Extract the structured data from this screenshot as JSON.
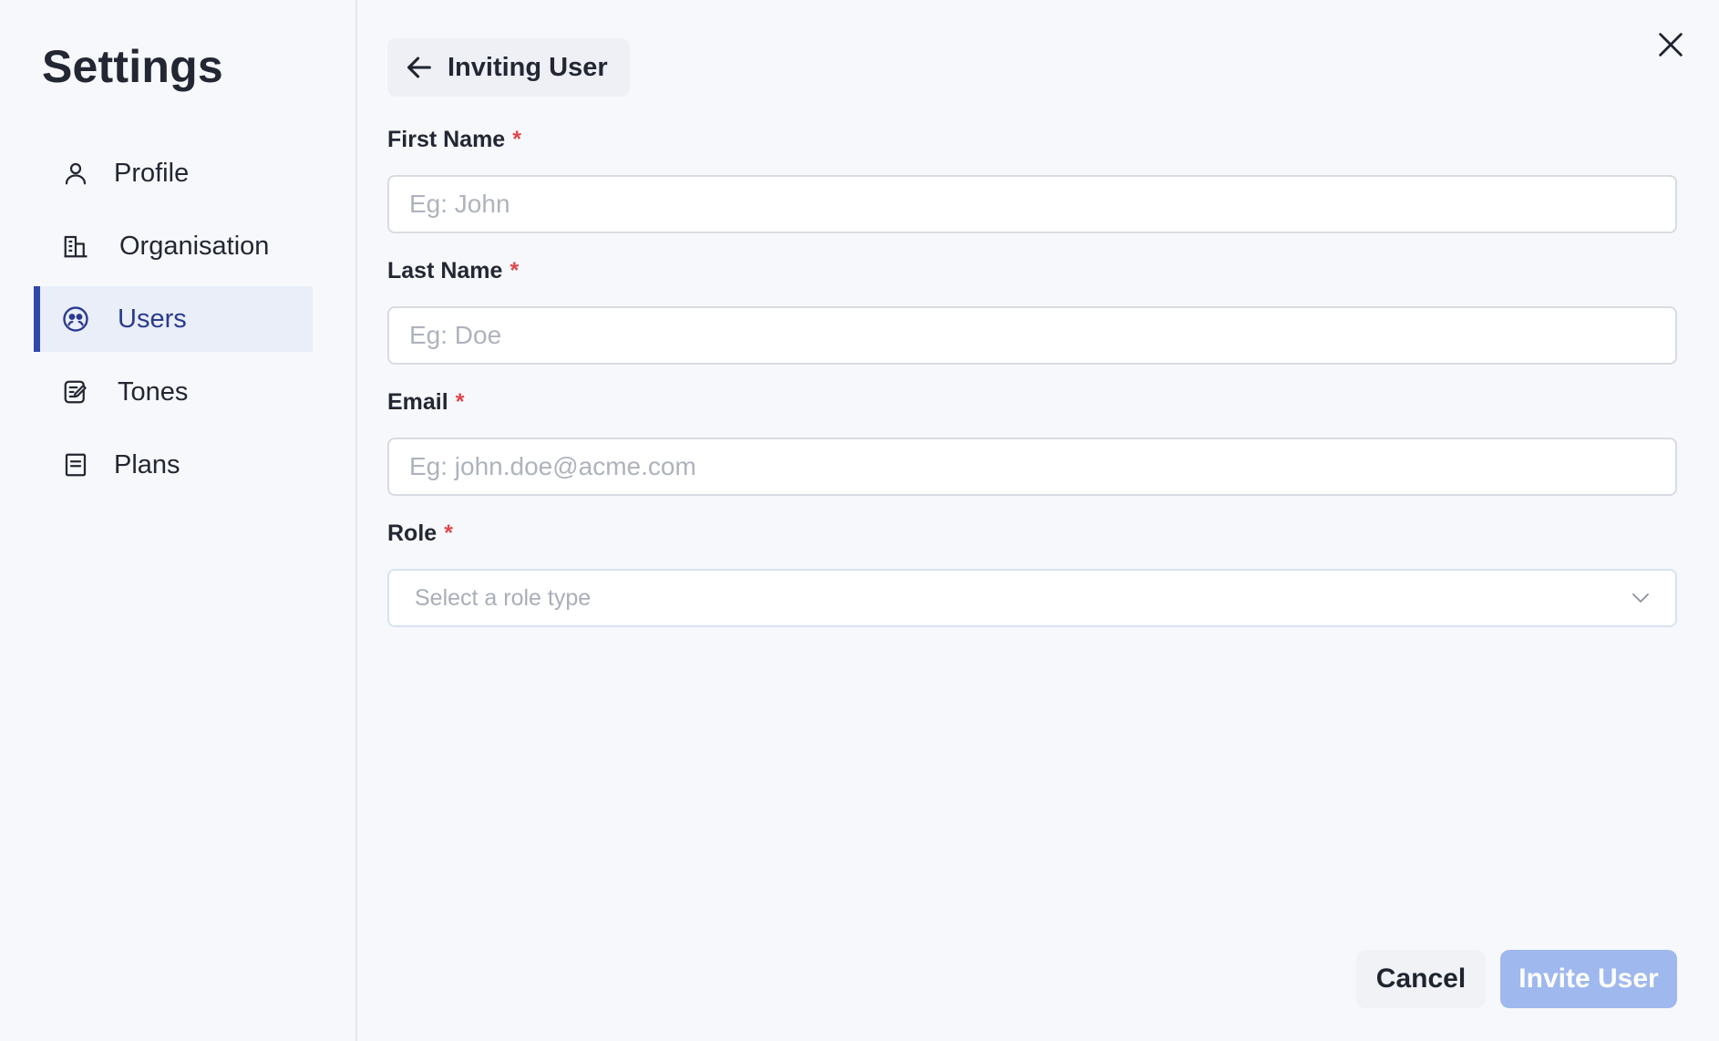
{
  "sidebar": {
    "title": "Settings",
    "items": [
      {
        "label": "Profile",
        "icon": "user-icon"
      },
      {
        "label": "Organisation",
        "icon": "building-icon"
      },
      {
        "label": "Users",
        "icon": "users-icon",
        "active": true
      },
      {
        "label": "Tones",
        "icon": "edit-note-icon"
      },
      {
        "label": "Plans",
        "icon": "document-icon"
      }
    ]
  },
  "header": {
    "back_label": "Inviting User"
  },
  "form": {
    "first_name": {
      "label": "First Name",
      "required_mark": "*",
      "placeholder": "Eg: John",
      "value": ""
    },
    "last_name": {
      "label": "Last Name",
      "required_mark": "*",
      "placeholder": "Eg: Doe",
      "value": ""
    },
    "email": {
      "label": "Email",
      "required_mark": "*",
      "placeholder": "Eg: john.doe@acme.com",
      "value": ""
    },
    "role": {
      "label": "Role",
      "required_mark": "*",
      "placeholder": "Select a role type"
    }
  },
  "actions": {
    "cancel_label": "Cancel",
    "invite_label": "Invite User"
  },
  "colors": {
    "accent": "#3347a8",
    "active_bg": "#e9eef8",
    "required": "#e0474c",
    "invite_disabled": "#9fb8ee"
  }
}
